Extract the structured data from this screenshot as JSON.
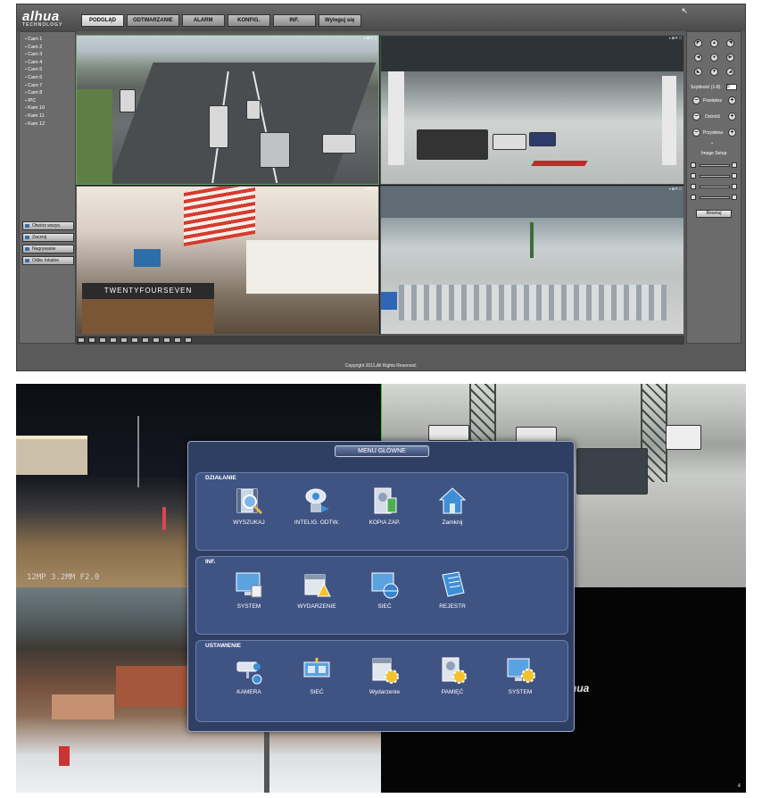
{
  "web_client": {
    "logo": "alhua",
    "logo_sub": "TECHNOLOGY",
    "nav": [
      "PODGLĄD",
      "ODTWARZANIE",
      "ALARM",
      "KONFIG.",
      "INF.",
      "Wyloguj się"
    ],
    "channels": [
      "Cam 1",
      "Cam 2",
      "Cam 3",
      "Cam 4",
      "Cam 5",
      "Cam 6",
      "Cam 7",
      "Cam 8",
      "IPC",
      "Kam 10",
      "Kam 11",
      "Kam 12"
    ],
    "left_buttons": [
      "Otwórz wszys.",
      "Zacznij",
      "Nagrywanie",
      "Odtw. lokalne"
    ],
    "ptz": {
      "speed_label": "Szybkość (1-8):",
      "speed_value": "5",
      "zoom_label": "Powiększ",
      "focus_label": "Ostrość",
      "iris_label": "Przysłona",
      "image_setup_label": "Image Setup",
      "reset_label": "Resetuj"
    },
    "storefront_text": "TWENTYFOURSEVEN",
    "copyright": "Copyright 2011,All Rights Reserved."
  },
  "nvr": {
    "cam_overlay": "12MP 3.2MM F2.0",
    "corner_number": "4",
    "background_brand": "hua",
    "menu": {
      "title": "MENU GŁÓWNE",
      "sections": [
        {
          "title": "DZIAŁANIE",
          "items": [
            "WYSZUKAJ",
            "INTELIG. ODTW.",
            "KOPIA ZAP.",
            "Zamknij"
          ]
        },
        {
          "title": "INF.",
          "items": [
            "SYSTEM",
            "WYDARZENIE",
            "SIEĆ",
            "REJESTR"
          ]
        },
        {
          "title": "USTAWIENIE",
          "items": [
            "KAMERA",
            "SIEĆ",
            "Wydarzenie",
            "PAMIĘĆ",
            "SYSTEM"
          ]
        }
      ]
    }
  },
  "colors": {
    "web_bg": "#5a5a5a",
    "menu_bg": "#2f3f63",
    "section_bg": "#405484",
    "accent_green": "#6ca36a"
  }
}
